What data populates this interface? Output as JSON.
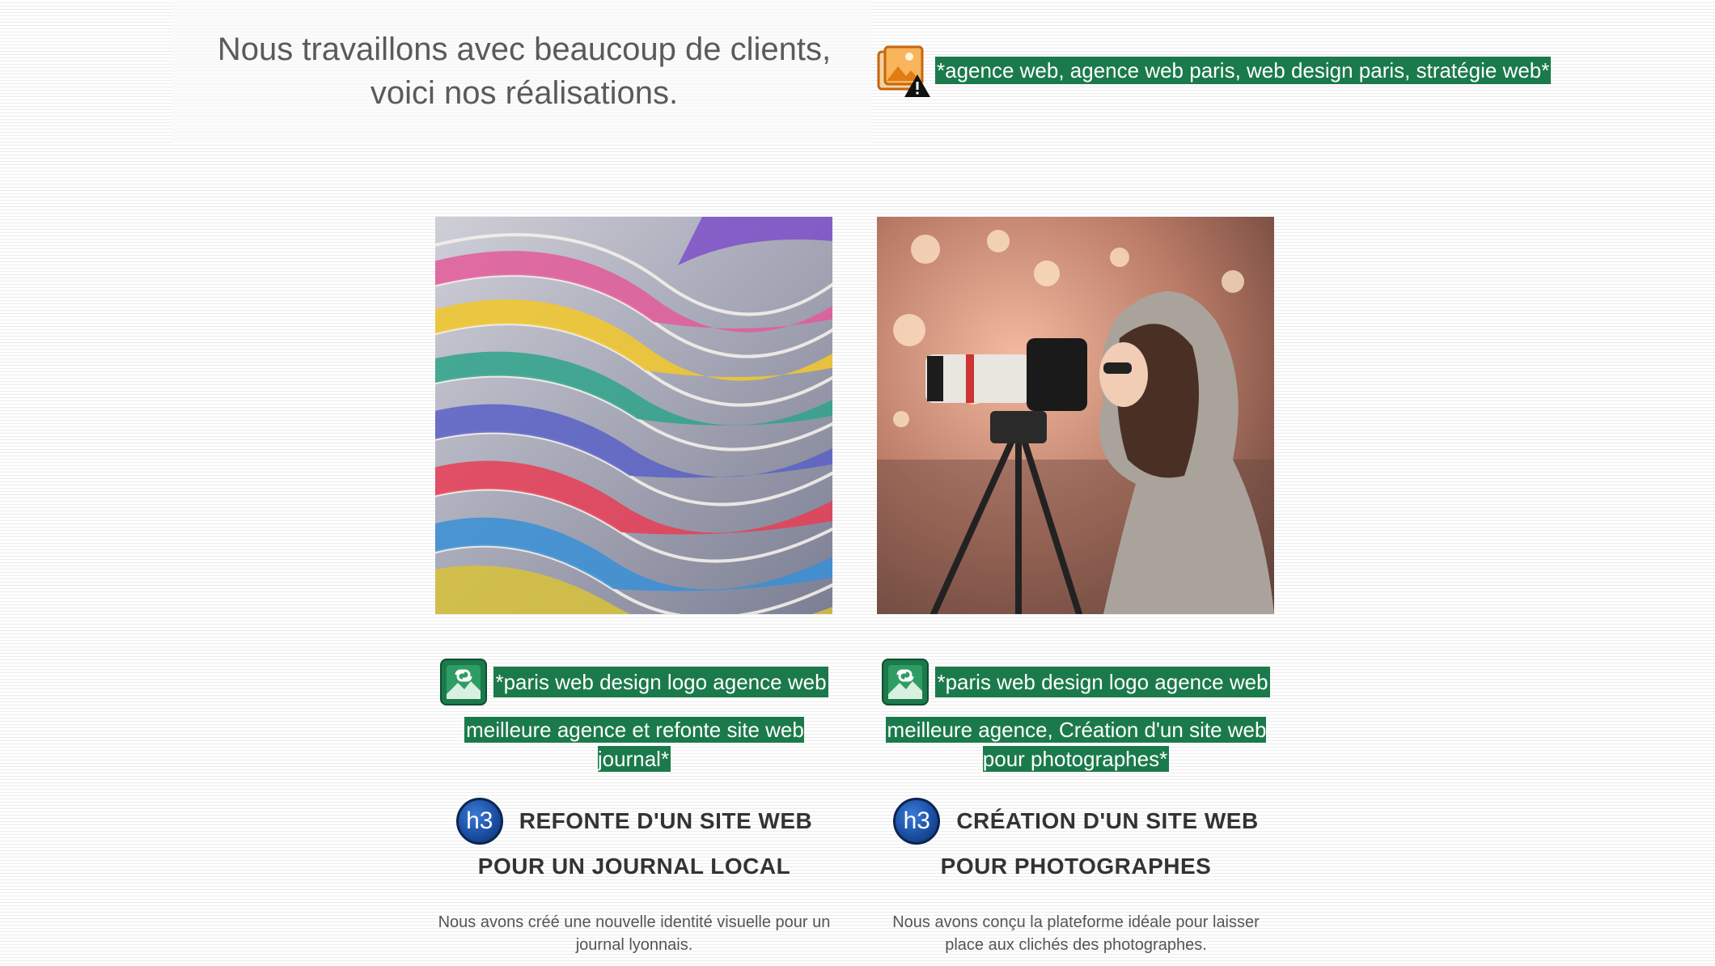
{
  "intro": {
    "text": "Nous travaillons avec beaucoup de clients, voici nos réalisations."
  },
  "header_image": {
    "icon": "broken-image-icon",
    "alt": "*agence web, agence web paris, web design paris, stratégie web*"
  },
  "colors": {
    "alt_highlight": "#1b7a4b",
    "h3_badge": "#1b4fa3",
    "text": "#333333"
  },
  "projects": [
    {
      "link_icon": "linked-image-icon",
      "alt_first": "*paris web design logo agence web",
      "alt_rest": "meilleure agence et refonte site web journal*",
      "badge": "h3",
      "title_first": "REFONTE D'UN SITE WEB",
      "title_rest": "POUR UN JOURNAL LOCAL",
      "description": "Nous avons créé une nouvelle identité visuelle pour un journal lyonnais."
    },
    {
      "link_icon": "linked-image-icon",
      "alt_first": "*paris web design logo agence web",
      "alt_rest": "meilleure agence, Création d'un site web pour photographes*",
      "badge": "h3",
      "title_first": "CRÉATION D'UN SITE WEB",
      "title_rest": "POUR PHOTOGRAPHES",
      "description": "Nous avons conçu la plateforme idéale pour laisser place aux clichés des photographes."
    }
  ]
}
